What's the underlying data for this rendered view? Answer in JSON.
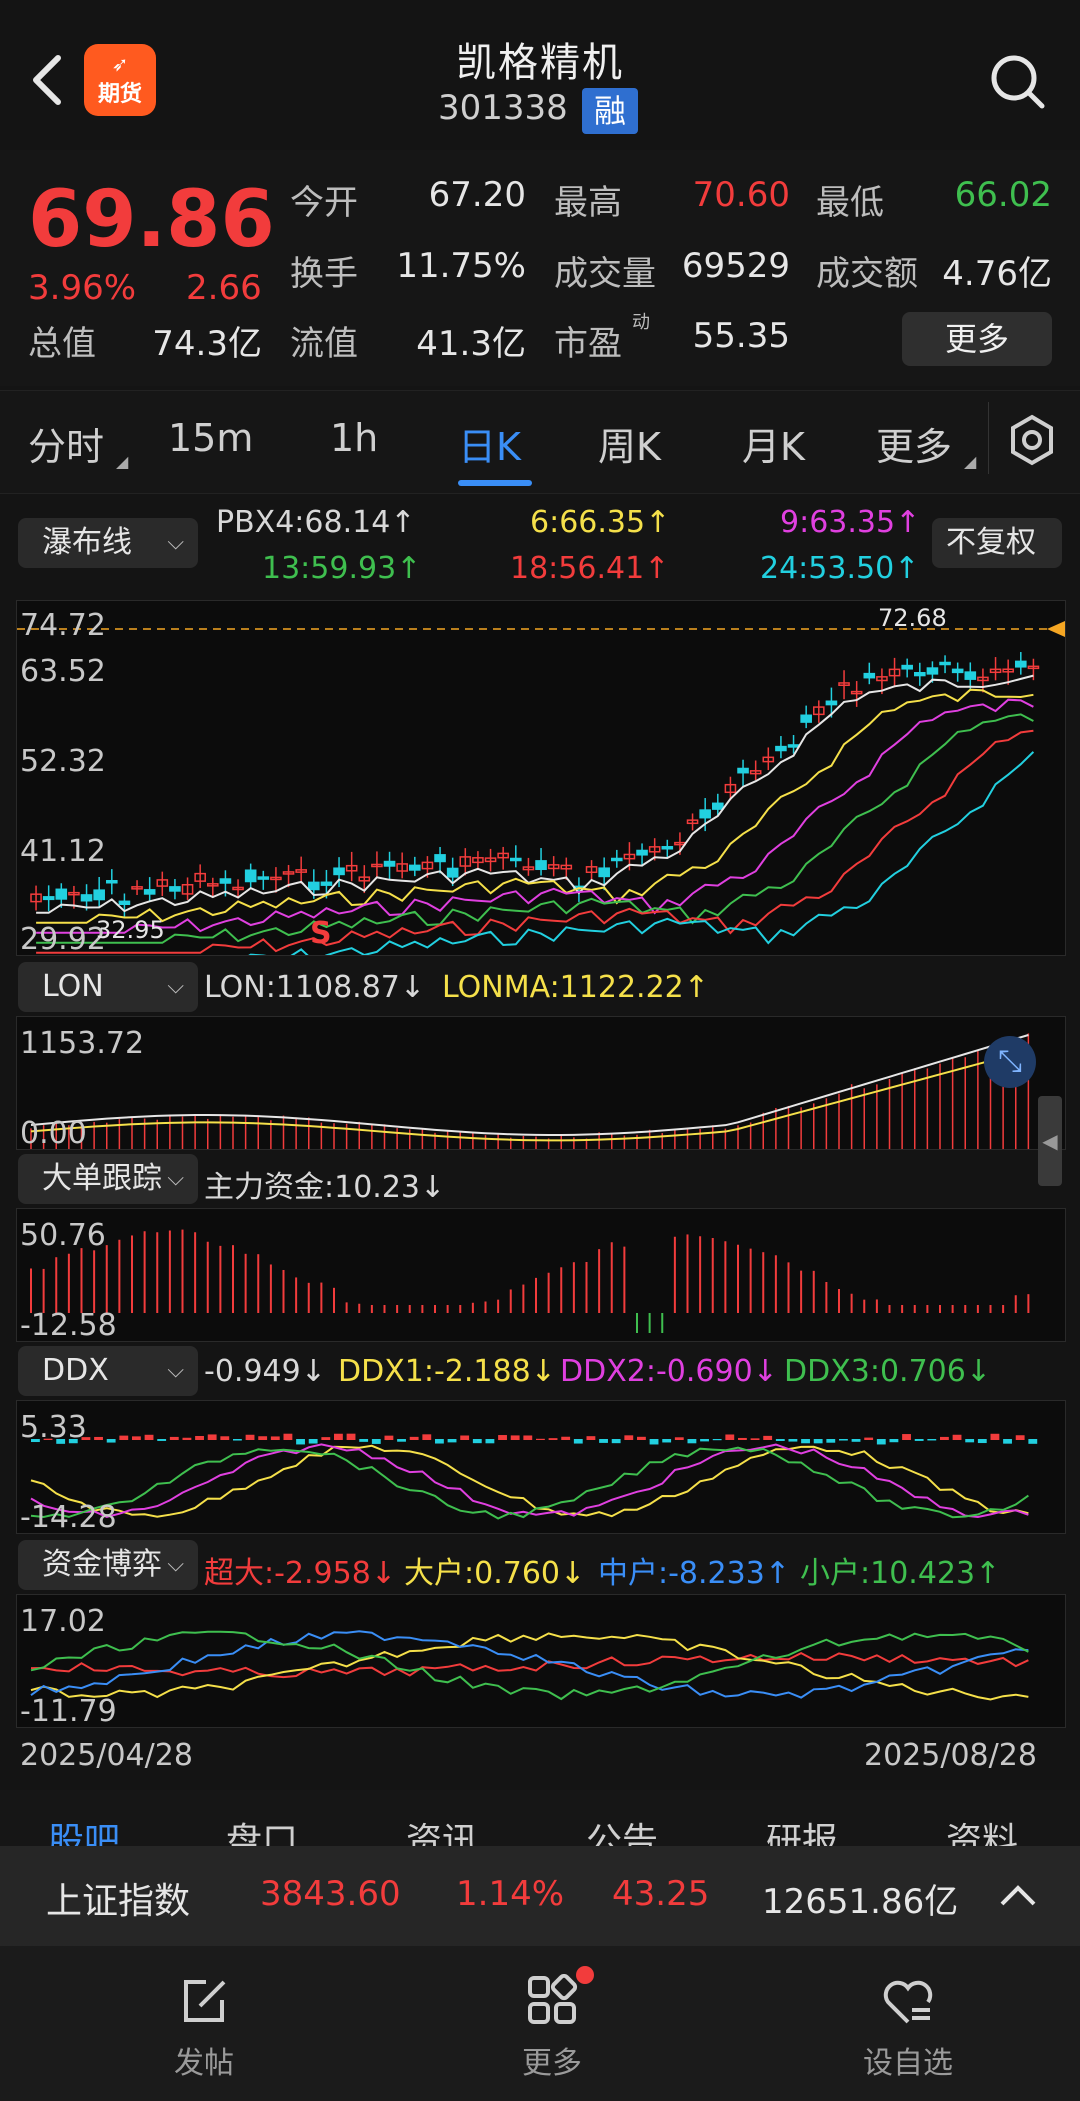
{
  "header": {
    "title": "凯格精机",
    "code": "301338",
    "margin_badge": "融",
    "futures_badge": "期货"
  },
  "quote": {
    "price": "69.86",
    "change_pct": "3.96%",
    "change": "2.66",
    "rows": [
      [
        {
          "label": "今开",
          "value": "67.20",
          "color": "white"
        },
        {
          "label": "最高",
          "value": "70.60",
          "color": "red"
        },
        {
          "label": "最低",
          "value": "66.02",
          "color": "green"
        }
      ],
      [
        {
          "label": "换手",
          "value": "11.75%",
          "color": "white"
        },
        {
          "label": "成交量",
          "value": "69529",
          "color": "white"
        },
        {
          "label": "成交额",
          "value": "4.76亿",
          "color": "white"
        }
      ]
    ],
    "total_value_label": "总值",
    "total_value": "74.3亿",
    "float_value_label": "流值",
    "float_value": "41.3亿",
    "pe_label": "市盈",
    "pe_super": "动",
    "pe_value": "55.35",
    "more_button": "更多"
  },
  "period_tabs": [
    "分时",
    "15m",
    "1h",
    "日K",
    "周K",
    "月K",
    "更多"
  ],
  "active_tab": "日K",
  "main_chart": {
    "selector": "瀑布线",
    "restore_button": "不复权",
    "legend": [
      {
        "text": "PBX4:68.14↑",
        "color": "#e6e6e6"
      },
      {
        "text": "6:66.35↑",
        "color": "#f5e04a"
      },
      {
        "text": "9:63.35↑",
        "color": "#e040e0"
      },
      {
        "text": "13:59.93↑",
        "color": "#3fbf4f"
      },
      {
        "text": "18:56.41↑",
        "color": "#f23c3c"
      },
      {
        "text": "24:53.50↑",
        "color": "#22d0e0"
      }
    ],
    "y_ticks": [
      "74.72",
      "63.52",
      "52.32",
      "41.12",
      "29.92"
    ],
    "high_label": "72.68",
    "low_label": "32.95",
    "signal_s": "S",
    "colors": {
      "up": "#f23c3c",
      "down": "#22d0e0",
      "dash": "#f5a623"
    }
  },
  "lon_panel": {
    "selector": "LON",
    "legend": [
      {
        "text": "LON:1108.87↓",
        "color": "#e6e6e6"
      },
      {
        "text": "LONMA:1122.22↑",
        "color": "#f5e04a"
      }
    ],
    "y_ticks": [
      "1153.72",
      "0.00"
    ]
  },
  "big_order_panel": {
    "selector": "大单跟踪",
    "legend": [
      {
        "text": "主力资金:10.23↓",
        "color": "#e6e6e6"
      }
    ],
    "y_ticks": [
      "50.76",
      "-12.58"
    ]
  },
  "ddx_panel": {
    "selector": "DDX",
    "legend": [
      {
        "text": "-0.949↓",
        "color": "#e6e6e6"
      },
      {
        "text": "DDX1:-2.188↓",
        "color": "#f5e04a"
      },
      {
        "text": "DDX2:-0.690↓",
        "color": "#e040e0"
      },
      {
        "text": "DDX3:0.706↓",
        "color": "#3fbf4f"
      }
    ],
    "y_ticks": [
      "5.33",
      "-14.28"
    ]
  },
  "fund_panel": {
    "selector": "资金博弈",
    "legend": [
      {
        "text": "超大:-2.958↓",
        "color": "#f23c3c"
      },
      {
        "text": "大户:0.760↓",
        "color": "#f5e04a"
      },
      {
        "text": "中户:-8.233↑",
        "color": "#3a8ef6"
      },
      {
        "text": "小户:10.423↑",
        "color": "#3fbf4f"
      }
    ],
    "y_ticks": [
      "17.02",
      "-11.79"
    ]
  },
  "date_range": {
    "start": "2025/04/28",
    "end": "2025/08/28"
  },
  "bottom_tabs": [
    "股吧",
    "盘口",
    "资讯",
    "公告",
    "研报",
    "资料"
  ],
  "index_bar": {
    "name": "上证指数",
    "value": "3843.60",
    "pct": "1.14%",
    "change": "43.25",
    "turnover": "12651.86亿"
  },
  "nav": {
    "post": "发帖",
    "more": "更多",
    "watchlist": "设自选"
  }
}
